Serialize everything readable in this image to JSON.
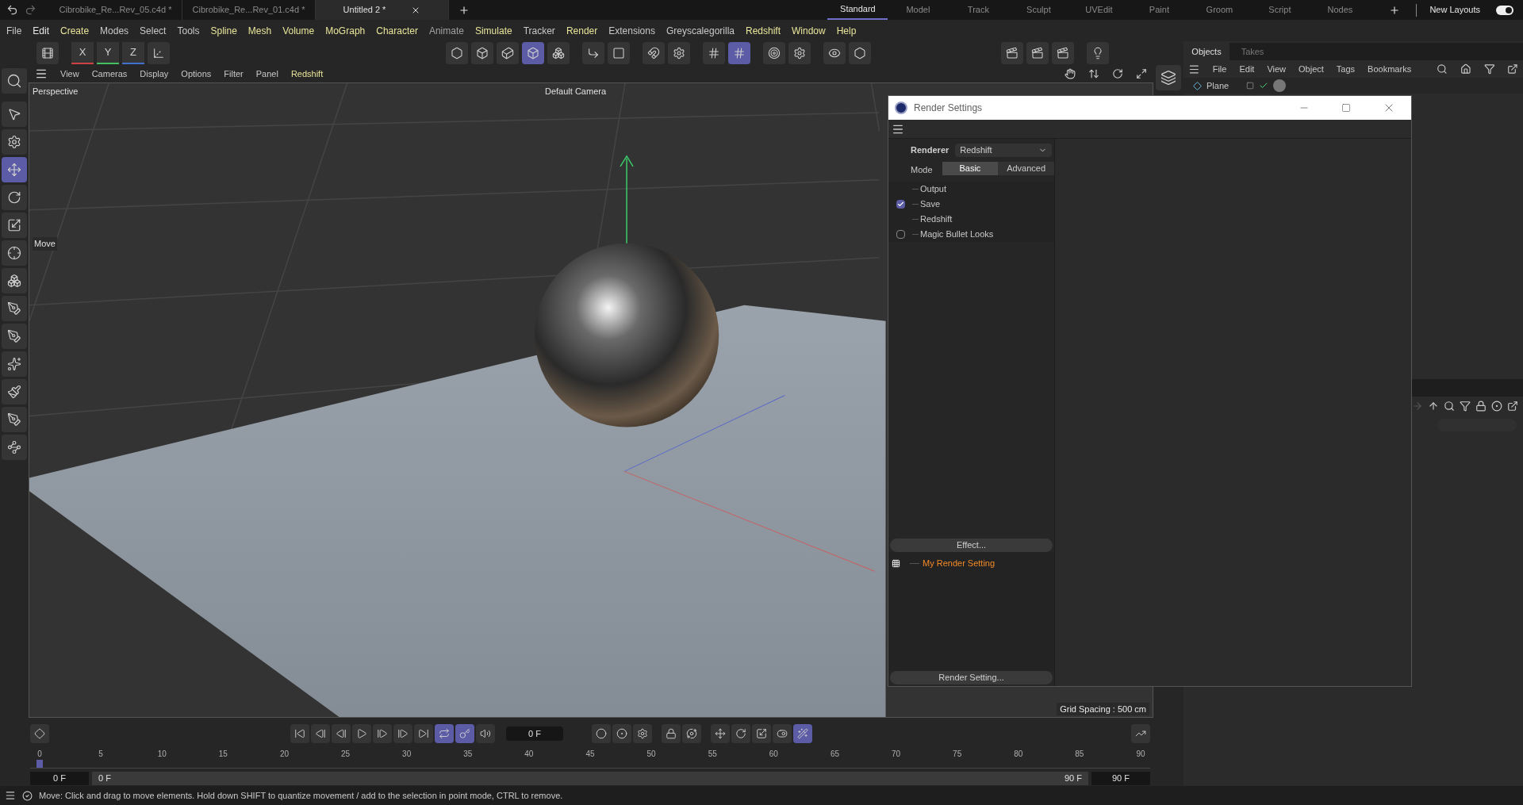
{
  "doc_tabs": [
    {
      "label": "Cibrobike_Re...Rev_05.c4d *",
      "selected": false
    },
    {
      "label": "Cibrobike_Re...Rev_01.c4d *",
      "selected": false
    },
    {
      "label": "Untitled 2 *",
      "selected": true
    }
  ],
  "layouts": [
    {
      "label": "Standard",
      "selected": true
    },
    {
      "label": "Model",
      "selected": false
    },
    {
      "label": "Track",
      "selected": false
    },
    {
      "label": "Sculpt",
      "selected": false
    },
    {
      "label": "UVEdit",
      "selected": false
    },
    {
      "label": "Paint",
      "selected": false
    },
    {
      "label": "Groom",
      "selected": false
    },
    {
      "label": "Script",
      "selected": false
    },
    {
      "label": "Nodes",
      "selected": false
    }
  ],
  "new_layouts": {
    "label": "New Layouts",
    "on": true
  },
  "menu": [
    {
      "label": "File",
      "color": "#c8c8c8"
    },
    {
      "label": "Edit",
      "color": "#e6e6e6"
    },
    {
      "label": "Create",
      "color": "#e8e49a"
    },
    {
      "label": "Modes",
      "color": "#c8c8c8"
    },
    {
      "label": "Select",
      "color": "#c8c8c8"
    },
    {
      "label": "Tools",
      "color": "#c8c8c8"
    },
    {
      "label": "Spline",
      "color": "#e8e49a"
    },
    {
      "label": "Mesh",
      "color": "#e8e49a"
    },
    {
      "label": "Volume",
      "color": "#e8e49a"
    },
    {
      "label": "MoGraph",
      "color": "#e8e49a"
    },
    {
      "label": "Character",
      "color": "#e8e49a"
    },
    {
      "label": "Animate",
      "color": "#a0a0a0"
    },
    {
      "label": "Simulate",
      "color": "#e8e49a"
    },
    {
      "label": "Tracker",
      "color": "#c8c8c8"
    },
    {
      "label": "Render",
      "color": "#e8e49a"
    },
    {
      "label": "Extensions",
      "color": "#c8c8c8"
    },
    {
      "label": "Greyscalegorilla",
      "color": "#c8c8c8"
    },
    {
      "label": "Redshift",
      "color": "#e8e49a"
    },
    {
      "label": "Window",
      "color": "#e8e49a"
    },
    {
      "label": "Help",
      "color": "#e8e49a"
    }
  ],
  "toolbar": {
    "axes": [
      "X",
      "Y",
      "Z"
    ],
    "mode_buttons": [
      {
        "selected": false
      },
      {
        "selected": false
      },
      {
        "selected": false
      },
      {
        "selected": true
      },
      {
        "selected": false
      }
    ],
    "snap_buttons": [
      {
        "selected": false
      },
      {
        "selected": true
      }
    ]
  },
  "tools": [
    {
      "selected": false
    },
    {
      "selected": false
    },
    {
      "selected": true
    },
    {
      "selected": false
    },
    {
      "selected": false
    },
    {
      "selected": false
    },
    {
      "selected": false
    },
    {
      "selected": false
    },
    {
      "selected": false
    },
    {
      "selected": false
    },
    {
      "selected": false
    },
    {
      "selected": false
    },
    {
      "selected": false
    }
  ],
  "viewport": {
    "menus": [
      {
        "label": "View",
        "color": "#c8c8c8"
      },
      {
        "label": "Cameras",
        "color": "#c8c8c8"
      },
      {
        "label": "Display",
        "color": "#c8c8c8"
      },
      {
        "label": "Options",
        "color": "#c8c8c8"
      },
      {
        "label": "Filter",
        "color": "#c8c8c8"
      },
      {
        "label": "Panel",
        "color": "#c8c8c8"
      },
      {
        "label": "Redshift",
        "color": "#e8e49a"
      }
    ],
    "camera_label": "Perspective",
    "camera_name": "Default Camera",
    "tool_hint": "Move",
    "grid_spacing": "Grid Spacing : 500 cm"
  },
  "objects_panel": {
    "tabs": [
      {
        "label": "Objects",
        "selected": true
      },
      {
        "label": "Takes",
        "selected": false
      }
    ],
    "menus": [
      "File",
      "Edit",
      "View",
      "Object",
      "Tags",
      "Bookmarks"
    ],
    "objects": [
      {
        "name": "Plane"
      }
    ]
  },
  "render_settings": {
    "title": "Render Settings",
    "renderer_label": "Renderer",
    "renderer": "Redshift",
    "mode_label": "Mode",
    "modes": [
      {
        "label": "Basic",
        "selected": true
      },
      {
        "label": "Advanced",
        "selected": false
      }
    ],
    "items": [
      {
        "label": "Output",
        "kind": "plain"
      },
      {
        "label": "Save",
        "kind": "checkable",
        "checked": true
      },
      {
        "label": "Redshift",
        "kind": "plain"
      },
      {
        "label": "Magic Bullet Looks",
        "kind": "checkable",
        "checked": false
      }
    ],
    "effect_button": "Effect...",
    "settings": [
      "My Render Setting"
    ],
    "render_setting_button": "Render Setting..."
  },
  "timeline": {
    "current_frame": "0 F",
    "loop_buttons": [
      {
        "selected": true
      },
      {
        "selected": true
      }
    ],
    "last_tool_selected": true,
    "ticks": [
      "0",
      "5",
      "10",
      "15",
      "20",
      "25",
      "30",
      "35",
      "40",
      "45",
      "50",
      "55",
      "60",
      "65",
      "70",
      "75",
      "80",
      "85",
      "90"
    ],
    "range_start": "0 F",
    "range_bar": {
      "level": 1,
      "start": "0 F",
      "end": "90 F"
    },
    "range_end": "90 F"
  },
  "status_bar": "Move: Click and drag to move elements. Hold down SHIFT to quantize movement / add to the selection in point mode, CTRL to remove."
}
